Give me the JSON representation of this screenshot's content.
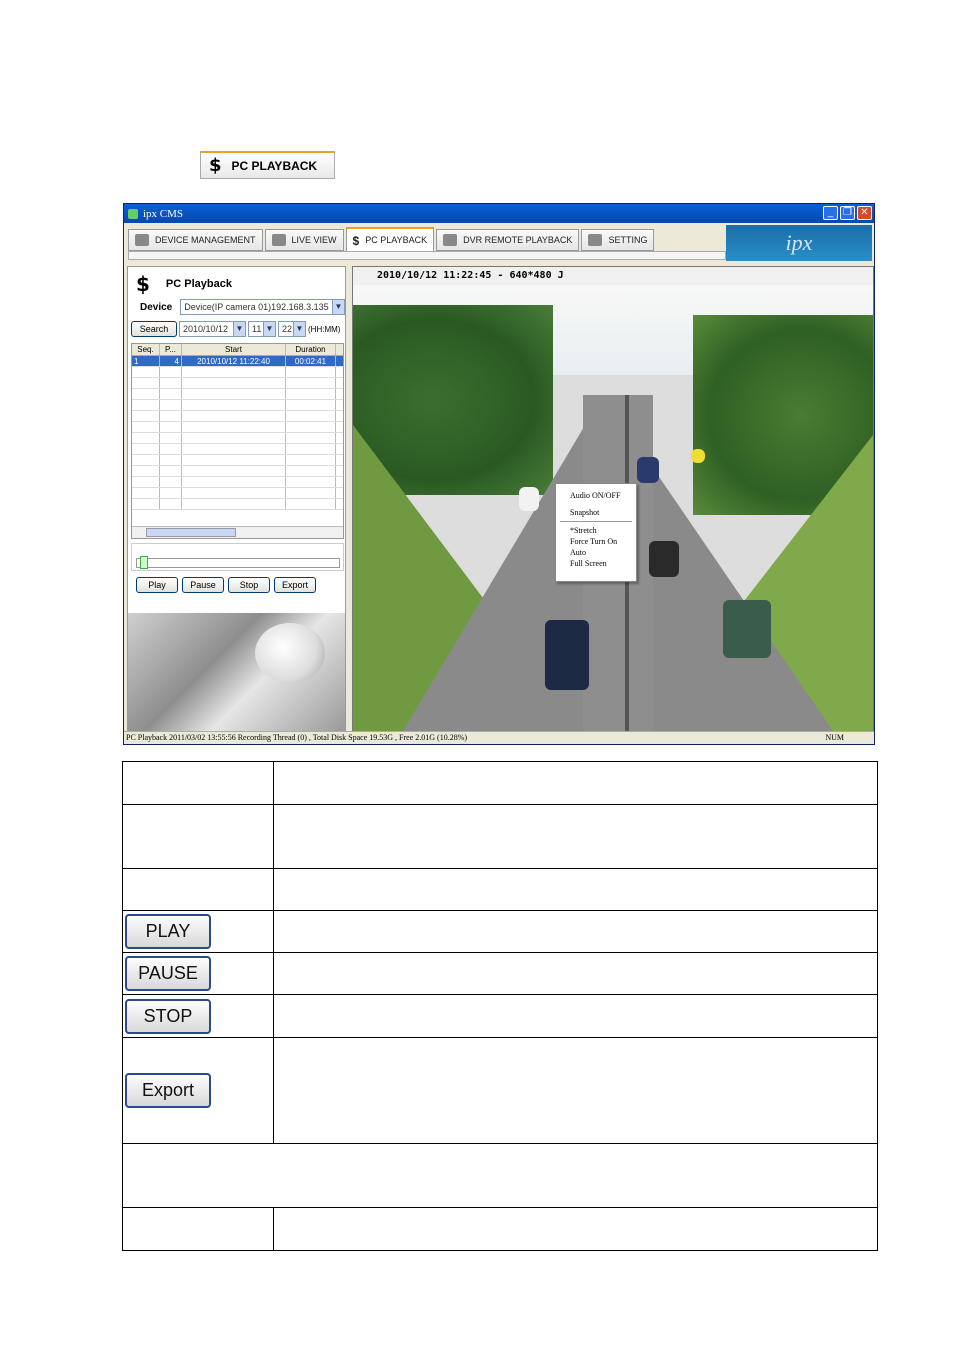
{
  "top_button": {
    "label": "PC PLAYBACK",
    "icon": "dollar-icon"
  },
  "window": {
    "title": "ipx CMS",
    "brand": "ipx",
    "tabs": [
      {
        "label": "DEVICE MANAGEMENT",
        "icon": "device-icon"
      },
      {
        "label": "LIVE VIEW",
        "icon": "eye-icon"
      },
      {
        "label": "PC PLAYBACK",
        "icon": "dollar-icon"
      },
      {
        "label": "DVR REMOTE PLAYBACK",
        "icon": "remote-icon"
      },
      {
        "label": "SETTING",
        "icon": "setting-icon"
      }
    ],
    "active_tab": "PC PLAYBACK"
  },
  "left_panel": {
    "title": "PC Playback",
    "device_label": "Device",
    "device_value": "Device(IP camera 01)192.168.3.135",
    "search_button": "Search",
    "date_value": "2010/10/12",
    "hour_value": "11",
    "minute_value": "22",
    "time_hint": "(HH:MM)",
    "columns": [
      "Seq.",
      "P...",
      "Start",
      "Duration"
    ],
    "rows": [
      [
        "1",
        "4",
        "2010/10/12 11:22:40",
        "00:02:41"
      ]
    ],
    "buttons": {
      "play": "Play",
      "pause": "Pause",
      "stop": "Stop",
      "export": "Export"
    }
  },
  "video": {
    "header": "2010/10/12 11:22:45 - 640*480 J",
    "context_menu": [
      "Audio ON/OFF",
      "Snapshot",
      "*Stretch",
      "Force Turn On",
      "Auto",
      "Full Screen"
    ]
  },
  "statusbar": {
    "text": "PC Playback   2011/03/02 13:55:56   Recording Thread (0) , Total Disk Space 19.53G , Free 2.01G (10.28%)",
    "num": "NUM"
  },
  "table_buttons": {
    "play": "PLAY",
    "pause": "PAUSE",
    "stop": "STOP",
    "export": "Export"
  }
}
